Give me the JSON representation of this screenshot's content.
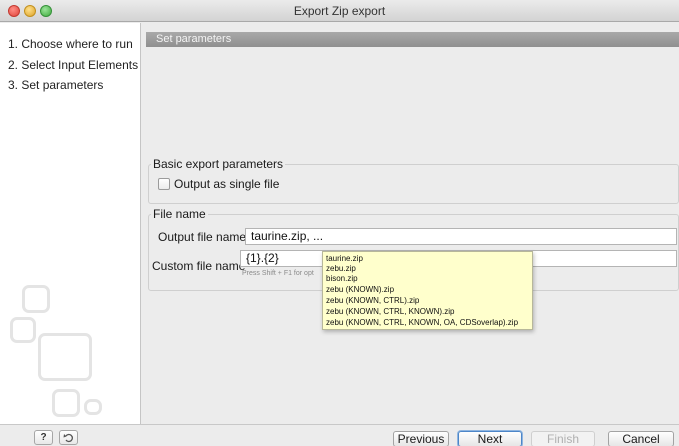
{
  "window": {
    "title": "Export Zip export"
  },
  "steps": [
    {
      "label": "1. Choose where to run"
    },
    {
      "label": "2. Select Input Elements"
    },
    {
      "label": "3. Set parameters"
    }
  ],
  "section": {
    "header": "Set parameters"
  },
  "basic_params": {
    "title": "Basic export parameters",
    "output_single_file_label": "Output as single file",
    "output_single_file_checked": false
  },
  "file_name": {
    "title": "File name",
    "output_label": "Output file name",
    "output_value": "taurine.zip, ...",
    "custom_label": "Custom file name",
    "custom_value": "{1}.{2}",
    "hint": "Press Shift + F1 for opt"
  },
  "suggestions": [
    "taurine.zip",
    "zebu.zip",
    "bison.zip",
    "zebu (KNOWN).zip",
    "zebu (KNOWN, CTRL).zip",
    "zebu (KNOWN, CTRL, KNOWN).zip",
    "zebu (KNOWN, CTRL, KNOWN, OA, CDSoverlap).zip"
  ],
  "footer": {
    "help": "?",
    "previous": "Previous",
    "next": "Next",
    "finish": "Finish",
    "cancel": "Cancel"
  }
}
